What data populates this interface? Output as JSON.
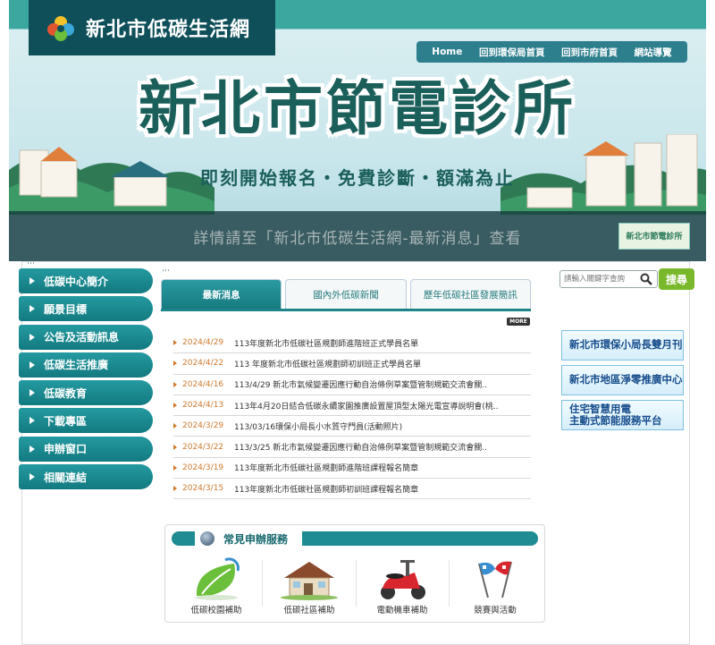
{
  "header": {
    "site_title": "新北市低碳生活網",
    "nav": [
      "Home",
      "回到環保局首頁",
      "回到市府首頁",
      "網站導覽"
    ]
  },
  "banner": {
    "title": "新北市節電診所",
    "subtitle": "即刻開始報名・免費診斷・額滿為止",
    "strip": "詳情請至「新北市低碳生活網-最新消息」查看",
    "thumb_label": "新北市節電診所"
  },
  "sidebar": {
    "items": [
      {
        "label": "低碳中心簡介"
      },
      {
        "label": "願景目標"
      },
      {
        "label": "公告及活動訊息"
      },
      {
        "label": "低碳生活推廣"
      },
      {
        "label": "低碳教育"
      },
      {
        "label": "下載專區"
      },
      {
        "label": "申辦窗口"
      },
      {
        "label": "相關連結"
      }
    ]
  },
  "tabs": [
    "最新消息",
    "國內外低碳新聞",
    "歷年低碳社區發展簡訊"
  ],
  "more_label": "MORE",
  "news": [
    {
      "date": "2024/4/29",
      "title": "113年度新北市低碳社區規劃師進階班正式學員名單"
    },
    {
      "date": "2024/4/22",
      "title": "113 年度新北市低碳社區規劃師初訓班正式學員名單"
    },
    {
      "date": "2024/4/16",
      "title": "113/4/29 新北市氣候變遷因應行動自治條例草案暨管制規範交流會關.."
    },
    {
      "date": "2024/4/13",
      "title": "113年4月20日結合低碳永續家園推廣設置屋頂型太陽光電宣導說明會(桃.."
    },
    {
      "date": "2024/3/29",
      "title": "113/03/16環保小局長小水質守門員(活動照片)"
    },
    {
      "date": "2024/3/22",
      "title": "113/3/25 新北市氣候變遷因應行動自治條例草案暨管制規範交流會關.."
    },
    {
      "date": "2024/3/19",
      "title": "113年度新北市低碳社區規劃師進階班課程報名簡章"
    },
    {
      "date": "2024/3/15",
      "title": "113年度新北市低碳社區規劃師初訓班課程報名簡章"
    }
  ],
  "search": {
    "placeholder": "請輸入關鍵字查詢",
    "button": "搜尋"
  },
  "promos": [
    {
      "line1": "新北市環保小局長雙月刊",
      "line2": ""
    },
    {
      "line1": "新北市地區淨零推廣中心",
      "line2": ""
    },
    {
      "line1": "住宅智慧用電",
      "line2": "主動式節能服務平台"
    }
  ],
  "services": {
    "title": "常見申辦服務",
    "items": [
      {
        "label": "低碳校園補助",
        "icon": "leaf-recycle-icon"
      },
      {
        "label": "低碳社區補助",
        "icon": "house-icon"
      },
      {
        "label": "電動機車補助",
        "icon": "scooter-icon"
      },
      {
        "label": "競賽與活動",
        "icon": "race-flags-icon"
      }
    ]
  },
  "colors": {
    "teal": "#1d8489",
    "dark_teal": "#0f4f5a",
    "date_orange": "#d07a2e",
    "search_green": "#7ab82b",
    "promo_blue": "#174d8c"
  }
}
